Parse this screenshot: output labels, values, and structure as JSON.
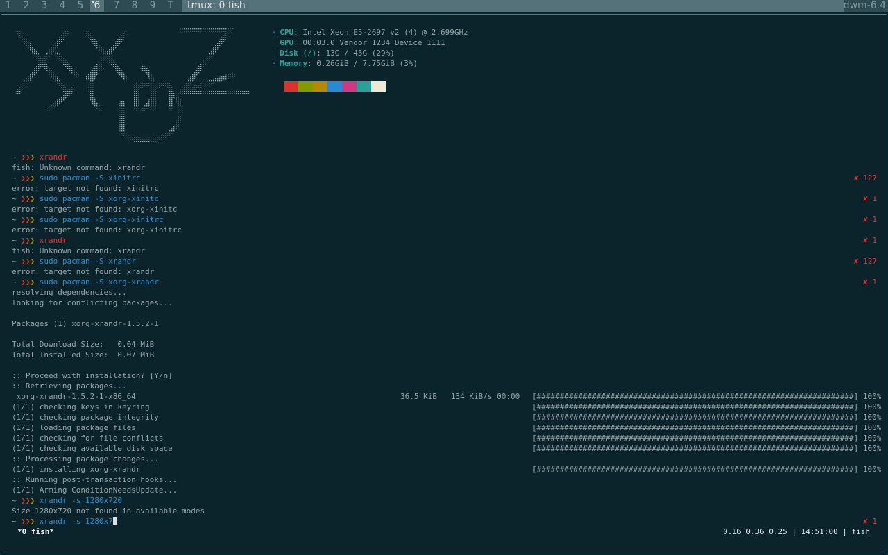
{
  "dwm_bar": {
    "tags": [
      {
        "label": "1",
        "selected": false
      },
      {
        "label": "2",
        "selected": false
      },
      {
        "label": "3",
        "selected": false
      },
      {
        "label": "4",
        "selected": false
      },
      {
        "label": "5",
        "selected": false
      },
      {
        "label": "6",
        "selected": true
      },
      {
        "label": "7",
        "selected": false
      },
      {
        "label": "8",
        "selected": false
      },
      {
        "label": "9",
        "selected": false
      },
      {
        "label": "T",
        "selected": false
      }
    ],
    "window_title": "tmux: 0 fish",
    "status": "dwm-6.4"
  },
  "sysinfo": {
    "cpu_label": "CPU",
    "cpu_value": ": Intel Xeon E5-2697 v2 (4) @ 2.699GHz",
    "gpu_label": "GPU",
    "gpu_value": ": 00:03.0 Vendor 1234 Device 1111",
    "disk_label": "Disk (/)",
    "disk_value": ": 13G / 45G (29%)",
    "memory_label": "Memory",
    "memory_value": ": 0.26GiB / 7.75GiB (3%)",
    "palette": [
      "#dc322f",
      "#859900",
      "#b58900",
      "#268bd2",
      "#d33682",
      "#2aa198",
      "#eee8d5"
    ]
  },
  "terminal": {
    "prompt_tilde": "~",
    "prompt_arrows": "❯❯❯",
    "error_mark": "✘",
    "commands": {
      "c1": "xrandr",
      "c2": "sudo pacman -S xinitrc",
      "c3": "sudo pacman -S xorg-xinitc",
      "c4": "sudo pacman -S xorg-xinitrc",
      "c5": "xrandr",
      "c6": "sudo pacman -S xrandr",
      "c7": "sudo pacman -S xorg-xrandr",
      "c8": "xrandr -s 1280x720",
      "c9": "xrandr -s 1280x7"
    },
    "exit_codes": {
      "c2": "127",
      "c3": "1",
      "c4": "1",
      "c5": "1",
      "c6": "127",
      "c7": "1",
      "c9": "1"
    },
    "output": {
      "o1": "fish: Unknown command: xrandr",
      "o2": "error: target not found: xinitrc",
      "o3": "error: target not found: xorg-xinitc",
      "o4": "error: target not found: xorg-xinitrc",
      "o5": "fish: Unknown command: xrandr",
      "o6": "error: target not found: xrandr",
      "o7": "resolving dependencies...",
      "o8": "looking for conflicting packages...",
      "o9": "Packages (1) xorg-xrandr-1.5.2-1",
      "o10": "Total Download Size:   0.04 MiB",
      "o11": "Total Installed Size:  0.07 MiB",
      "o12": ":: Proceed with installation? [Y/n]",
      "o13": ":: Retrieving packages...",
      "o14": " xorg-xrandr-1.5.2-1-x86_64",
      "o15": "(1/1) checking keys in keyring",
      "o16": "(1/1) checking package integrity",
      "o17": "(1/1) loading package files",
      "o18": "(1/1) checking for file conflicts",
      "o19": "(1/1) checking available disk space",
      "o20": ":: Processing package changes...",
      "o21": "(1/1) installing xorg-xrandr",
      "o22": ":: Running post-transaction hooks...",
      "o23": "(1/1) Arming ConditionNeedsUpdate...",
      "o24": "Size 1280x720 not found in available modes"
    },
    "download_stats": "36.5 KiB   134 KiB/s 00:00",
    "progress_bar": "[#####################################################################] 100%"
  },
  "tmux": {
    "window_label": "*0 fish*",
    "status_right": "0.16 0.36 0.25 | 14:51:00 | fish"
  }
}
